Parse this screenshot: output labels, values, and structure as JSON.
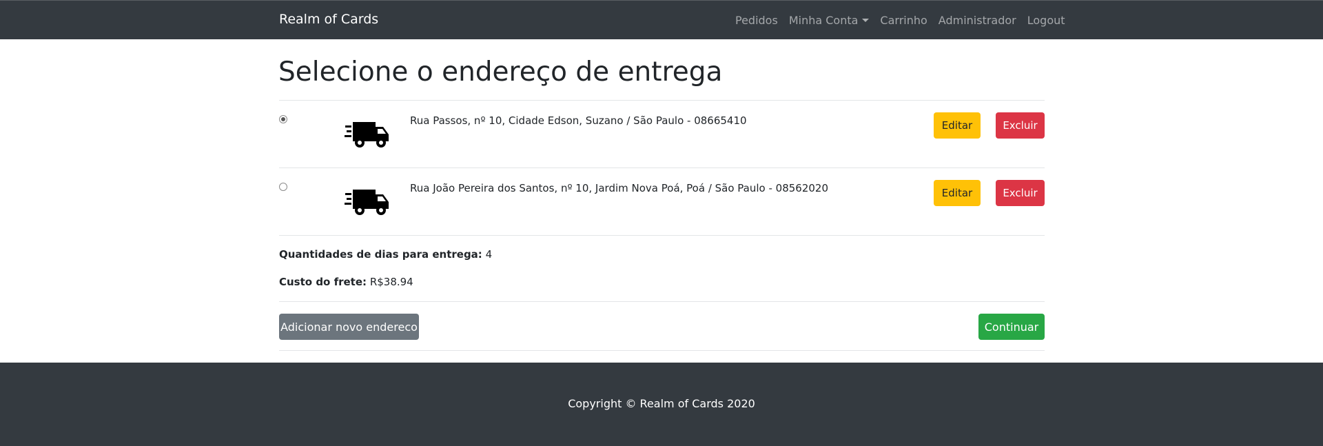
{
  "navbar": {
    "brand": "Realm of Cards",
    "items": [
      {
        "label": "Pedidos"
      },
      {
        "label": "Minha Conta"
      },
      {
        "label": "Carrinho"
      },
      {
        "label": "Administrador"
      },
      {
        "label": "Logout"
      }
    ]
  },
  "main": {
    "title": "Selecione o endereço de entrega",
    "addresses": [
      {
        "text": "Rua Passos, nº 10, Cidade Edson, Suzano / São Paulo - 08665410",
        "selected": true,
        "edit_label": "Editar",
        "delete_label": "Excluir",
        "icon": "truck-icon"
      },
      {
        "text": "Rua João Pereira dos Santos, nº 10, Jardim Nova Poá, Poá / São Paulo - 08562020",
        "selected": false,
        "edit_label": "Editar",
        "delete_label": "Excluir",
        "icon": "truck-icon"
      }
    ],
    "delivery_days_label": "Quantidades de dias para entrega:",
    "delivery_days_value": "4",
    "shipping_cost_label": "Custo do frete:",
    "shipping_cost_value": "R$38.94",
    "add_address_label": "Adicionar novo endereco",
    "continue_label": "Continuar"
  },
  "footer": {
    "copyright": "Copyright © Realm of Cards 2020"
  },
  "colors": {
    "navbar_bg": "#343a40",
    "warning": "#ffc107",
    "danger": "#dc3545",
    "secondary": "#6c757d",
    "success": "#28a745"
  }
}
